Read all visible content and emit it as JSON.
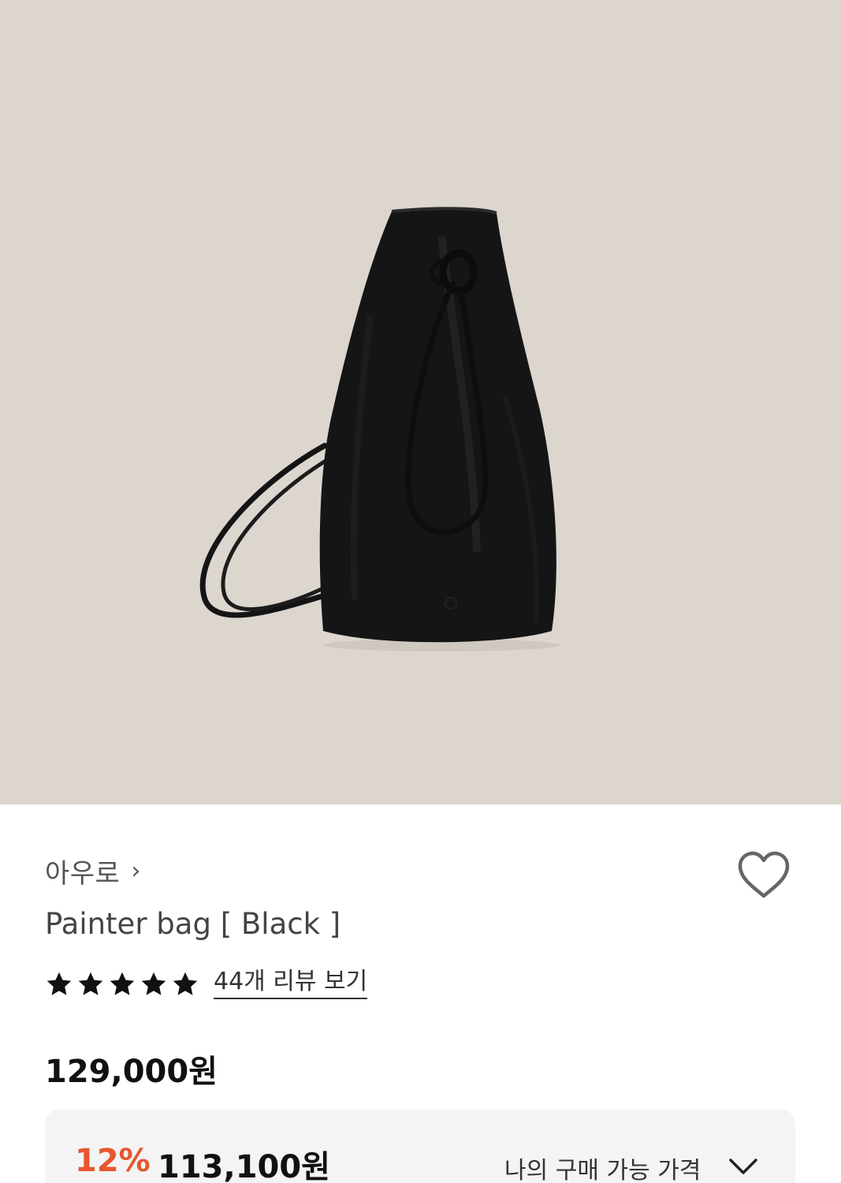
{
  "product_image": {
    "alt": "Painter bag [ Black ]",
    "background": "#dcd6cf",
    "bag_color": "#141414"
  },
  "brand": {
    "name": "아우로",
    "chevron": "›"
  },
  "wishlist": {
    "icon": "heart-outline-icon"
  },
  "product": {
    "title": "Painter bag [ Black ]"
  },
  "rating": {
    "stars": 5,
    "review_link": "44개 리뷰 보기"
  },
  "price": {
    "original": "129,000원",
    "discount_rate": "12%",
    "discount_price": "113,100원",
    "buyable_label": "나의 구매 가능 가격",
    "accent_color": "#e8562f"
  }
}
